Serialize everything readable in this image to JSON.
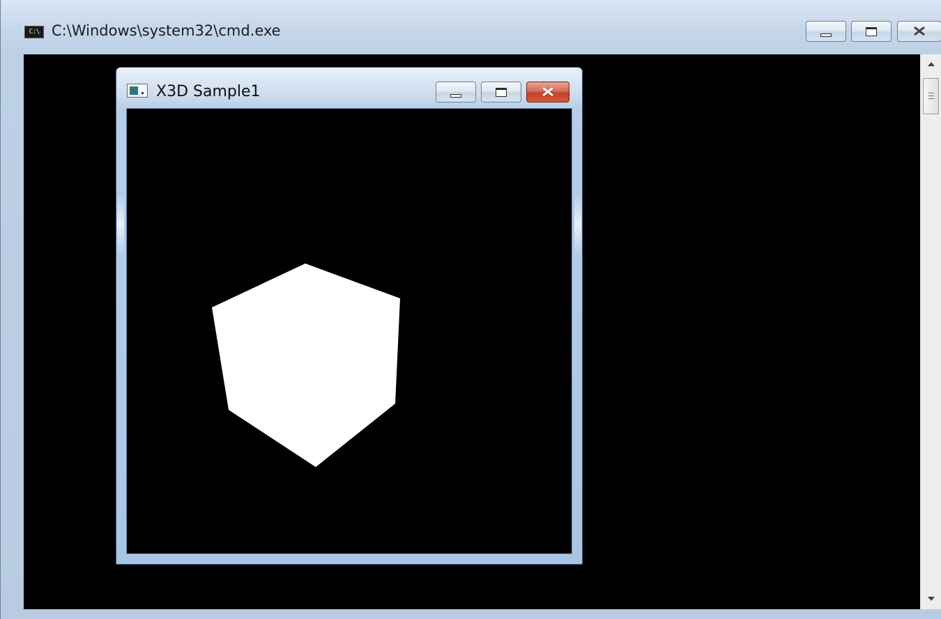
{
  "cmd_window": {
    "title": "C:\\Windows\\system32\\cmd.exe",
    "icon_text": "C:\\",
    "icon": "cmd-prompt-icon",
    "buttons": [
      "minimize-icon",
      "maximize-icon",
      "close-icon"
    ],
    "background": "#000000"
  },
  "x3d_window": {
    "title": "X3D Sample1",
    "icon": "application-window-icon",
    "buttons": [
      "minimize-icon",
      "maximize-icon",
      "close-icon"
    ],
    "close_button_color": "#c7432b",
    "viewport": {
      "background": "#000000",
      "object_color": "#ffffff",
      "object": "cube"
    }
  }
}
